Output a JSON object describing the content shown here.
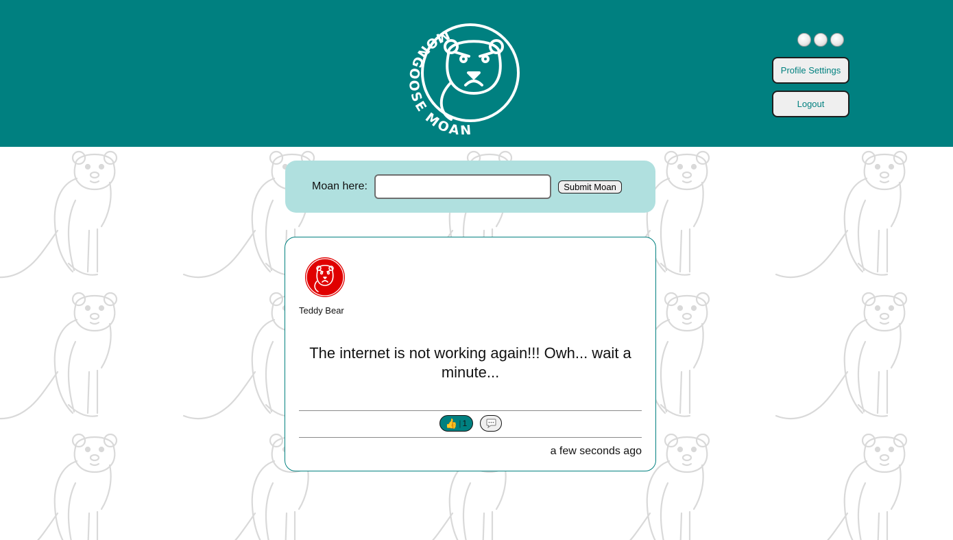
{
  "header": {
    "logo_text": "MONGOOSE MOAN",
    "theme_options": [
      "theme-1",
      "theme-2",
      "theme-3"
    ],
    "profile_settings_label": "Profile Settings",
    "logout_label": "Logout"
  },
  "moan_form": {
    "label": "Moan here:",
    "input_value": "",
    "submit_label": "Submit Moan"
  },
  "post": {
    "author": "Teddy Bear",
    "text": "The internet is not working again!!! Owh... wait a minute...",
    "like_count": "1",
    "like_icon": "thumbs-up-icon",
    "comment_icon": "speech-bubble-icon",
    "timestamp": "a few seconds ago"
  },
  "colors": {
    "brand": "#008080",
    "form_background": "#b0e0df",
    "avatar": "#e00000",
    "pattern": "#d8d8d8"
  }
}
